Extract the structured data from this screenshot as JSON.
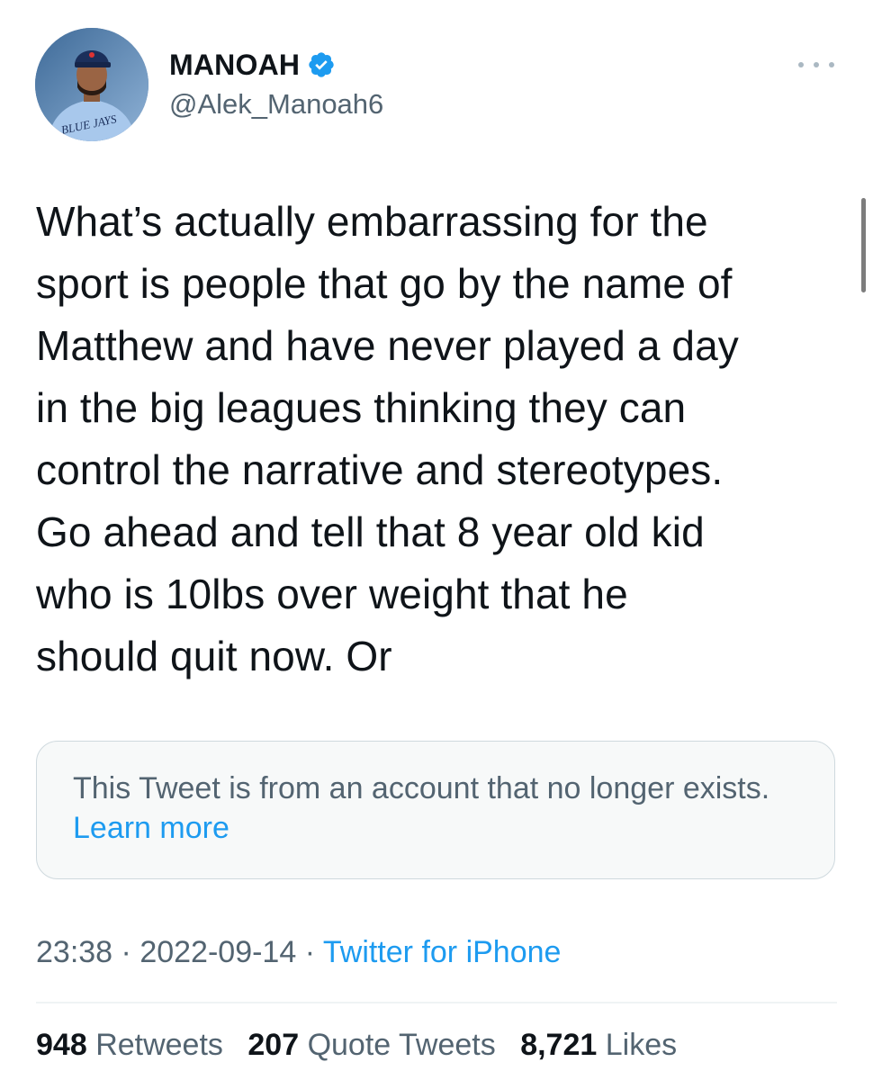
{
  "header": {
    "display_name": "MANOAH",
    "handle": "@Alek_Manoah6",
    "avatar_caption": "BLUE JAYS"
  },
  "tweet": {
    "text_lines": [
      "What’s actually embarrassing for the",
      "sport is people that go by the name of",
      "Matthew and have never played a day",
      "in the big leagues thinking they can",
      "control the narrative and stereotypes.",
      "Go ahead and tell that 8 year old kid",
      "who is 10lbs over weight that he",
      "should quit now. Or"
    ]
  },
  "notice": {
    "text": "This Tweet is from an account that no longer exists.",
    "link": "Learn more"
  },
  "meta": {
    "time": "23:38",
    "separator": "·",
    "date": "2022-09-14",
    "source": "Twitter for iPhone"
  },
  "stats": {
    "retweets_count": "948",
    "retweets_label": "Retweets",
    "quotes_count": "207",
    "quotes_label": "Quote Tweets",
    "likes_count": "8,721",
    "likes_label": "Likes"
  },
  "icons": {
    "verified": "verified-badge-icon",
    "more": "more-options-icon"
  },
  "colors": {
    "accent": "#1d9bf0",
    "secondary_text": "#536471",
    "primary_text": "#0f1419",
    "notice_bg": "#f7f9f9",
    "border": "#cfd9de"
  }
}
